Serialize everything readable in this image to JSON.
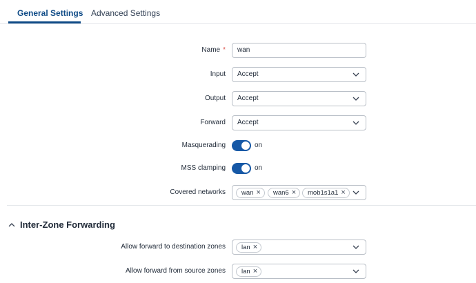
{
  "tabs": [
    {
      "label": "General Settings",
      "active": true
    },
    {
      "label": "Advanced Settings",
      "active": false
    }
  ],
  "form": {
    "name": {
      "label": "Name",
      "required_mark": "*",
      "value": "wan"
    },
    "input": {
      "label": "Input",
      "value": "Accept"
    },
    "output": {
      "label": "Output",
      "value": "Accept"
    },
    "forward": {
      "label": "Forward",
      "value": "Accept"
    },
    "masquerading": {
      "label": "Masquerading",
      "state": "on"
    },
    "mss_clamping": {
      "label": "MSS clamping",
      "state": "on"
    },
    "covered_networks": {
      "label": "Covered networks",
      "chips": [
        "wan",
        "wan6",
        "mob1s1a1"
      ]
    }
  },
  "inter_zone": {
    "title": "Inter-Zone Forwarding",
    "dest": {
      "label": "Allow forward to destination zones",
      "chips": [
        "lan"
      ]
    },
    "src": {
      "label": "Allow forward from source zones",
      "chips": [
        "lan"
      ]
    }
  },
  "icons": {
    "chip_remove": "×",
    "dropdown": "chevron-down-icon",
    "section_toggle": "chevron-up-icon"
  },
  "colors": {
    "accent": "#0e4a86",
    "toggle_on": "#1658a6",
    "required": "#d9473f",
    "border": "#b9bfc7"
  }
}
